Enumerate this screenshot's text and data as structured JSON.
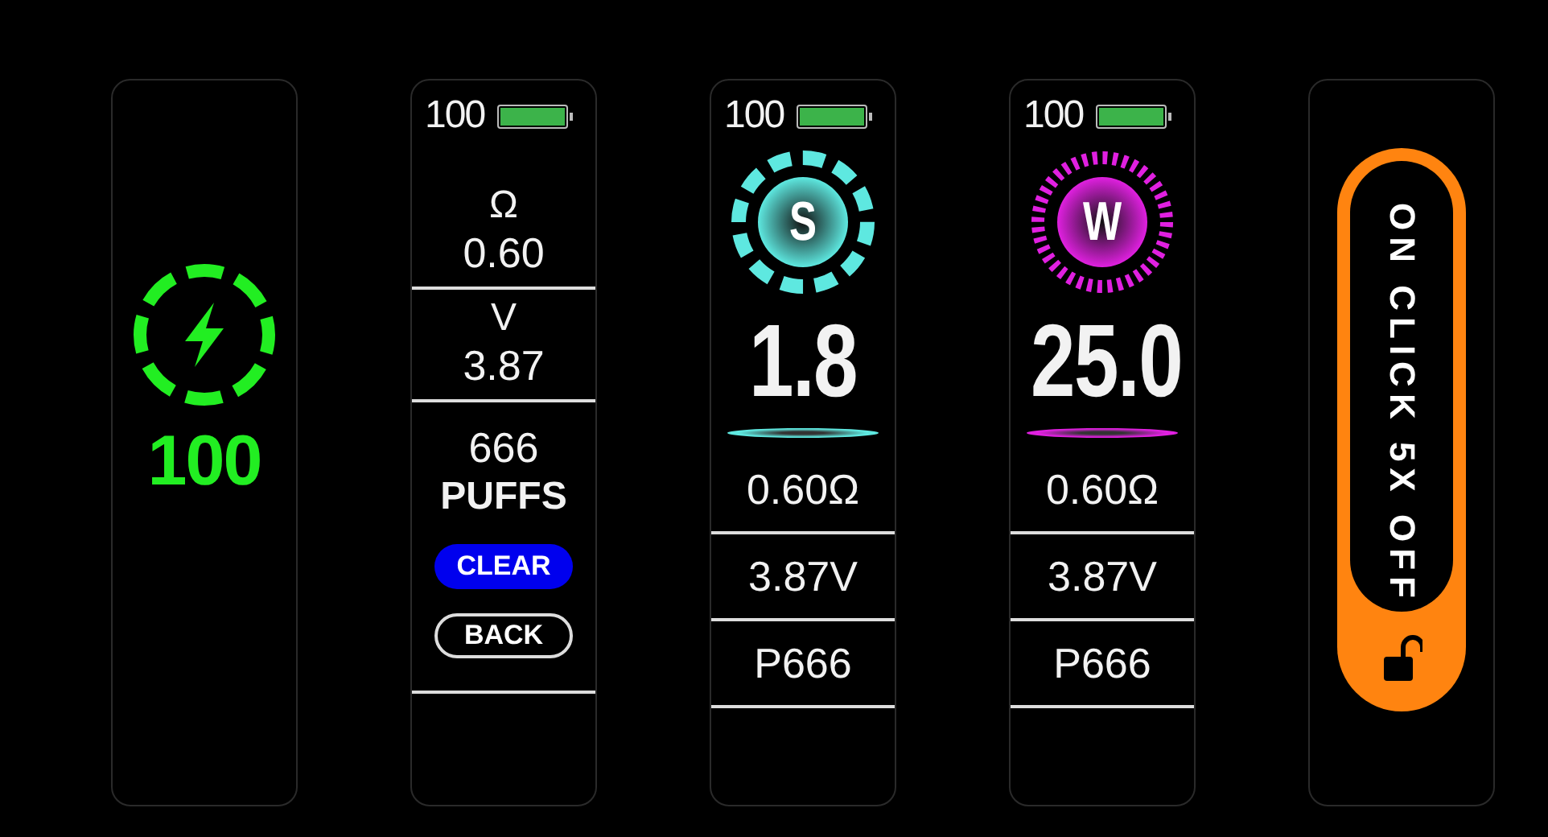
{
  "screens": [
    {
      "kind": "charging",
      "reading": "100"
    },
    {
      "kind": "stats",
      "battery": {
        "reading": "100",
        "level": 1
      },
      "rows": [
        {
          "symbol": "Ω",
          "value": "0.60"
        },
        {
          "symbol": "V",
          "value": "3.87"
        }
      ],
      "puffs": {
        "count": "666",
        "label": "PUFFS"
      },
      "buttons": [
        {
          "label": "CLEAR",
          "kind": "filled"
        },
        {
          "label": "BACK",
          "kind": "outline"
        }
      ]
    },
    {
      "kind": "mode",
      "battery": {
        "reading": "100",
        "level": 1
      },
      "mode": {
        "letter": "S",
        "kind": "segments",
        "color": "#5ee8e0"
      },
      "value": "1.8",
      "rows": [
        "0.60Ω",
        "3.87V",
        "P666"
      ]
    },
    {
      "kind": "mode",
      "battery": {
        "reading": "100",
        "level": 1
      },
      "mode": {
        "letter": "W",
        "kind": "ticks",
        "color": "#e020e0"
      },
      "value": "25.0",
      "rows": [
        "0.60Ω",
        "3.87V",
        "P666"
      ]
    },
    {
      "kind": "lock",
      "message": "ON CLICK 5X OFF",
      "locked": false
    }
  ]
}
